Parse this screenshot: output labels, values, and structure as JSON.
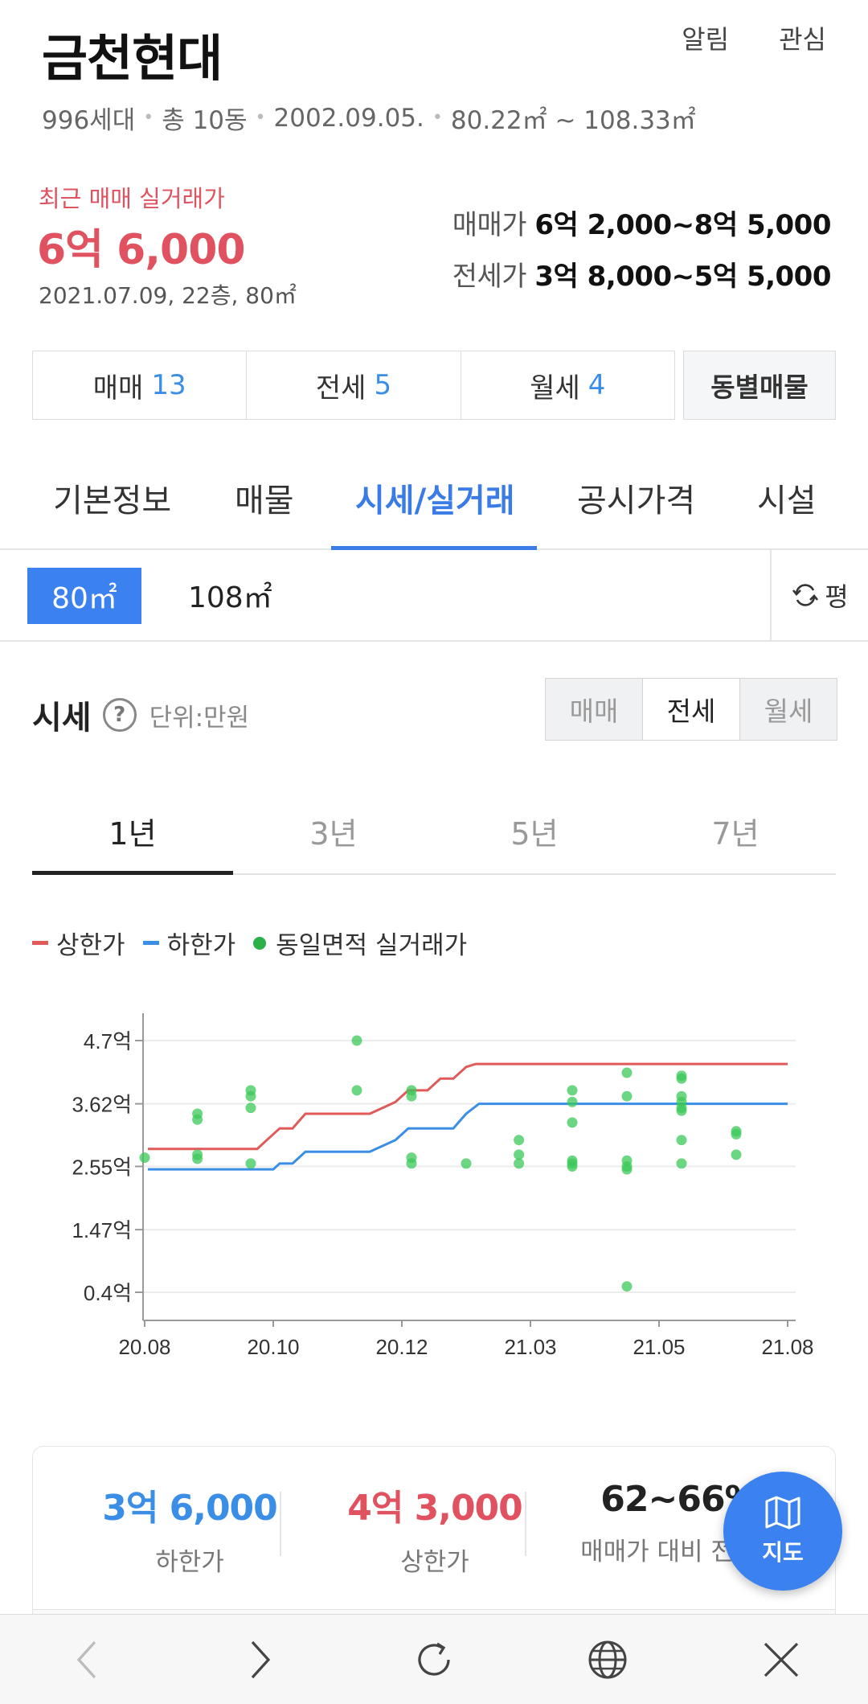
{
  "header": {
    "title": "금천현대",
    "alarm": "알림",
    "favorite": "관심",
    "households": "996세대",
    "buildings": "총 10동",
    "date": "2002.09.05.",
    "area_range": "80.22㎡ ~ 108.33㎡"
  },
  "recent": {
    "label": "최근 매매 실거래가",
    "price": "6억 6,000",
    "detail": "2021.07.09, 22층, 80㎡"
  },
  "ranges": {
    "sale_label": "매매가",
    "sale_value": "6억 2,000~8억 5,000",
    "jeonse_label": "전세가",
    "jeonse_value": "3억 8,000~5억 5,000"
  },
  "counts": [
    {
      "label": "매매",
      "count": "13"
    },
    {
      "label": "전세",
      "count": "5"
    },
    {
      "label": "월세",
      "count": "4"
    }
  ],
  "dong_button": "동별매물",
  "tabs": [
    "기본정보",
    "매물",
    "시세/실거래",
    "공시가격",
    "시설"
  ],
  "active_tab": "시세/실거래",
  "areas": {
    "selected": "80㎡",
    "other": "108㎡",
    "unit_toggle": "평"
  },
  "price_section": {
    "title": "시세",
    "unit": "단위:만원",
    "types": [
      "매매",
      "전세",
      "월세"
    ],
    "active_type": "전세"
  },
  "periods": [
    "1년",
    "3년",
    "5년",
    "7년"
  ],
  "active_period": "1년",
  "legend": {
    "upper": "상한가",
    "lower": "하한가",
    "deals": "동일면적 실거래가"
  },
  "colors": {
    "upper": "#e05a5a",
    "lower": "#3a8ee6",
    "deals": "#3cc85a",
    "accent": "#3b82f0"
  },
  "chart_data": {
    "type": "line",
    "y_tick_labels": [
      "4.7억",
      "3.62억",
      "2.55억",
      "1.47억",
      "0.4억"
    ],
    "y_ticks": [
      4.7,
      3.62,
      2.55,
      1.47,
      0.4
    ],
    "ylim": [
      0,
      5.1
    ],
    "x_tick_labels": [
      "20.08",
      "20.10",
      "20.12",
      "21.03",
      "21.05",
      "21.08"
    ],
    "x_ticks": [
      0,
      2,
      4,
      6,
      8,
      10
    ],
    "xlim": [
      0,
      10
    ],
    "series": [
      {
        "name": "상한가",
        "points": [
          [
            0.05,
            2.85
          ],
          [
            1.75,
            2.85
          ],
          [
            1.9,
            3.0
          ],
          [
            2.1,
            3.2
          ],
          [
            2.3,
            3.2
          ],
          [
            2.5,
            3.45
          ],
          [
            3.5,
            3.45
          ],
          [
            3.7,
            3.55
          ],
          [
            3.9,
            3.65
          ],
          [
            4.1,
            3.85
          ],
          [
            4.4,
            3.85
          ],
          [
            4.6,
            4.05
          ],
          [
            4.8,
            4.05
          ],
          [
            5.0,
            4.25
          ],
          [
            5.15,
            4.3
          ],
          [
            10,
            4.3
          ]
        ]
      },
      {
        "name": "하한가",
        "points": [
          [
            0.05,
            2.5
          ],
          [
            2.0,
            2.5
          ],
          [
            2.1,
            2.6
          ],
          [
            2.3,
            2.6
          ],
          [
            2.5,
            2.8
          ],
          [
            3.5,
            2.8
          ],
          [
            3.7,
            2.9
          ],
          [
            3.9,
            3.0
          ],
          [
            4.1,
            3.2
          ],
          [
            4.8,
            3.2
          ],
          [
            5.0,
            3.45
          ],
          [
            5.2,
            3.62
          ],
          [
            10,
            3.62
          ]
        ]
      }
    ],
    "deals": [
      [
        0.0,
        2.7
      ],
      [
        0.82,
        3.45
      ],
      [
        0.82,
        3.35
      ],
      [
        0.82,
        2.75
      ],
      [
        0.82,
        2.68
      ],
      [
        1.65,
        3.85
      ],
      [
        1.65,
        3.75
      ],
      [
        1.65,
        3.55
      ],
      [
        1.65,
        2.6
      ],
      [
        3.3,
        4.7
      ],
      [
        3.3,
        3.85
      ],
      [
        4.15,
        3.85
      ],
      [
        4.15,
        3.75
      ],
      [
        4.15,
        2.7
      ],
      [
        4.15,
        2.6
      ],
      [
        5.0,
        2.6
      ],
      [
        5.82,
        3.0
      ],
      [
        5.82,
        2.75
      ],
      [
        5.82,
        2.6
      ],
      [
        6.65,
        3.85
      ],
      [
        6.65,
        3.65
      ],
      [
        6.65,
        3.3
      ],
      [
        6.65,
        2.65
      ],
      [
        6.65,
        2.6
      ],
      [
        6.65,
        2.55
      ],
      [
        7.5,
        4.15
      ],
      [
        7.5,
        3.75
      ],
      [
        7.5,
        2.65
      ],
      [
        7.5,
        2.55
      ],
      [
        7.5,
        2.5
      ],
      [
        7.5,
        0.5
      ],
      [
        8.35,
        4.1
      ],
      [
        8.35,
        4.05
      ],
      [
        8.35,
        3.75
      ],
      [
        8.35,
        3.65
      ],
      [
        8.35,
        3.55
      ],
      [
        8.35,
        3.5
      ],
      [
        8.35,
        3.0
      ],
      [
        8.35,
        2.6
      ],
      [
        9.2,
        3.15
      ],
      [
        9.2,
        3.1
      ],
      [
        9.2,
        2.75
      ]
    ]
  },
  "summary": {
    "lower_value": "3억 6,000",
    "lower_label": "하한가",
    "upper_value": "4억 3,000",
    "upper_label": "상한가",
    "ratio_value": "62~66%",
    "ratio_label": "매매가 대비 전세가"
  },
  "map_button": "지도"
}
